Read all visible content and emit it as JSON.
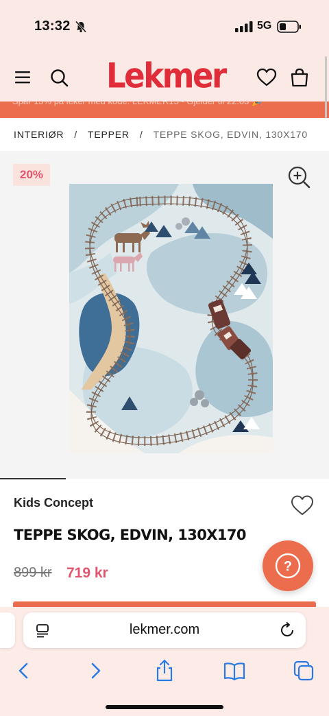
{
  "status_bar": {
    "time": "13:32",
    "network": "5G"
  },
  "header": {
    "logo": "Lekmer",
    "brand_color": "#e12d39",
    "accent_color": "#ec6d4e",
    "icons": [
      "menu-icon",
      "search-icon",
      "heart-icon",
      "bag-icon"
    ]
  },
  "promo": {
    "text": "Spar 15% på leker med kode: LEKMER15 - Gjelder til 22.03 🎉"
  },
  "breadcrumb": {
    "items": [
      "INTERIØR",
      "TEPPER"
    ],
    "current": "TEPPE SKOG, EDVIN, 130X170"
  },
  "gallery": {
    "discount_badge": "20%"
  },
  "product": {
    "brand": "Kids Concept",
    "title": "TEPPE SKOG, EDVIN, 130X170",
    "old_price": "899 kr",
    "price": "719 kr",
    "help_label": "?"
  },
  "browser": {
    "url": "lekmer.com",
    "toolbar": [
      "back-icon",
      "forward-icon",
      "share-icon",
      "bookmarks-icon",
      "tabs-icon"
    ]
  }
}
